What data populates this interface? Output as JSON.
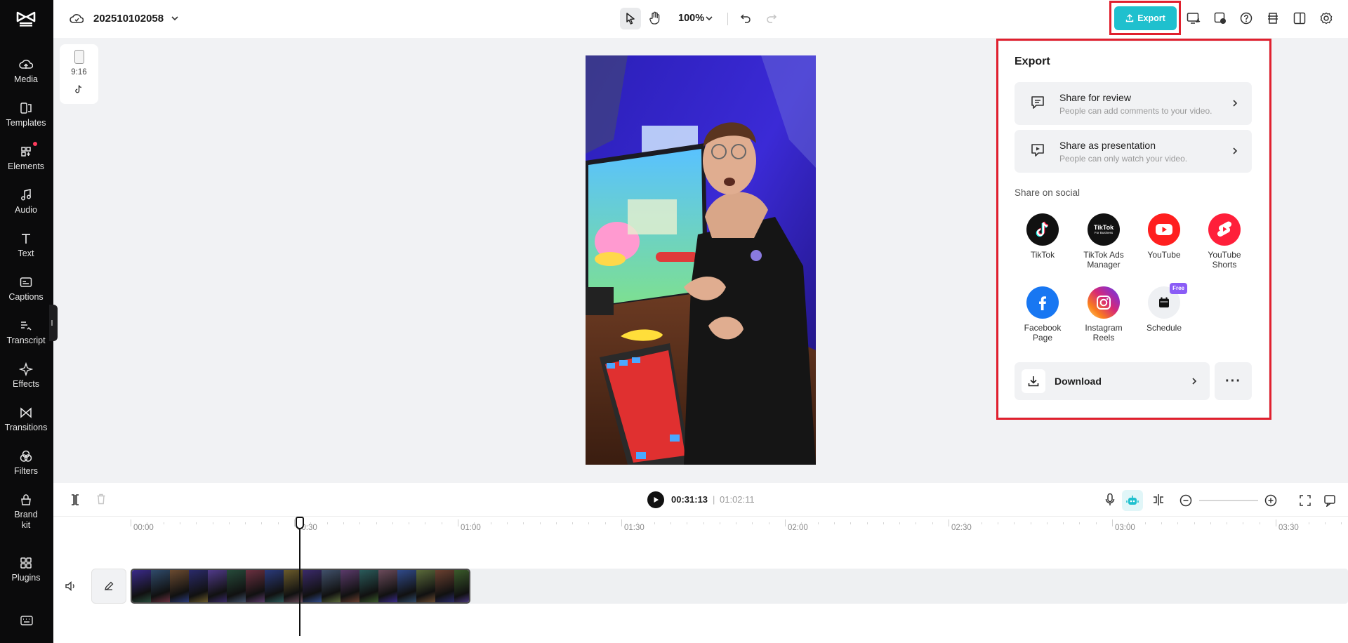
{
  "app": {
    "project_title": "202510102058",
    "zoom_level": "100%",
    "export_label": "Export",
    "accent_color": "#1fc0ce"
  },
  "rail": {
    "items": [
      {
        "label": "Media",
        "icon": "cloud-upload-icon"
      },
      {
        "label": "Templates",
        "icon": "templates-icon"
      },
      {
        "label": "Elements",
        "icon": "elements-icon",
        "has_badge": true
      },
      {
        "label": "Audio",
        "icon": "music-note-icon"
      },
      {
        "label": "Text",
        "icon": "text-icon"
      },
      {
        "label": "Captions",
        "icon": "captions-icon"
      },
      {
        "label": "Transcript",
        "icon": "transcript-icon"
      },
      {
        "label": "Effects",
        "icon": "sparkle-icon"
      },
      {
        "label": "Transitions",
        "icon": "transitions-icon"
      },
      {
        "label": "Filters",
        "icon": "filters-icon"
      },
      {
        "label": "Brand\nkit",
        "icon": "brand-kit-icon"
      },
      {
        "label": "Plugins",
        "icon": "plugins-icon"
      }
    ]
  },
  "canvas": {
    "aspect_ratio": "9:16"
  },
  "export_panel": {
    "title": "Export",
    "share_review": {
      "title": "Share for review",
      "subtitle": "People can add comments to your video."
    },
    "share_presentation": {
      "title": "Share as presentation",
      "subtitle": "People can only watch your video."
    },
    "social_label": "Share on social",
    "social": [
      {
        "label": "TikTok",
        "icon": "tiktok-icon"
      },
      {
        "label": "TikTok Ads Manager",
        "icon": "tiktok-ads-icon",
        "logo_text": "TikTok",
        "logo_subtext": "For Business"
      },
      {
        "label": "YouTube",
        "icon": "youtube-icon"
      },
      {
        "label": "YouTube Shorts",
        "icon": "youtube-shorts-icon"
      },
      {
        "label": "Facebook Page",
        "icon": "facebook-icon"
      },
      {
        "label": "Instagram Reels",
        "icon": "instagram-icon"
      },
      {
        "label": "Schedule",
        "icon": "calendar-icon",
        "badge": "Free"
      }
    ],
    "download_label": "Download",
    "more_label": "···"
  },
  "timeline": {
    "current_time": "00:31:13",
    "separator": "|",
    "total_time": "01:02:11",
    "ruler_labels": [
      "00:00",
      "00:30",
      "01:00",
      "01:30",
      "02:00",
      "02:30",
      "03:00",
      "03:30"
    ],
    "playhead_seconds": 31
  }
}
